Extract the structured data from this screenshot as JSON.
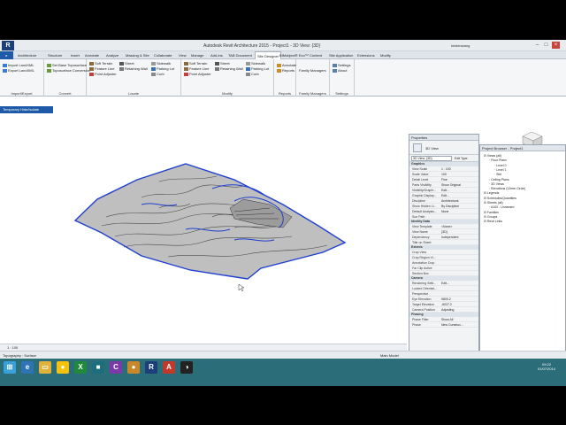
{
  "window": {
    "title": "Autodesk Revit Architecture 2015 -    Project1 - 3D View: {3D}",
    "search_hint": "Type a keyword or phrase",
    "user": "kristenwang",
    "logo": "R"
  },
  "tabs": [
    "Architecture",
    "Structure",
    "Insert",
    "Annotate",
    "Analyze",
    "Massing & Site",
    "Collaborate",
    "View",
    "Manage",
    "Add-Ins",
    "TAB Document",
    "Site Designer",
    "BIMobject® Eco™",
    "Content",
    "Site Application",
    "Extensions",
    "Modify"
  ],
  "active_tab_index": 11,
  "ribbon": {
    "panels": [
      {
        "title": "Import/Export",
        "items": [
          "Import LandXML",
          "Export LandXML"
        ]
      },
      {
        "title": "Convert",
        "items": [
          "Set Base Toposurface",
          "Toposurface Conversion"
        ]
      },
      {
        "title": "Locate",
        "items": [
          "Soft Terrain",
          "Feature Line",
          "Point Adjuster",
          "Street",
          "Retaining Wall",
          "Sidewalk",
          "Parking Lot",
          "Curb"
        ]
      },
      {
        "title": "Modify",
        "items": [
          "Soft Terrain",
          "Feature Line",
          "Point Adjuster",
          "Street",
          "Retaining Wall",
          "Sidewalk",
          "Parking Lot",
          "Curb"
        ]
      },
      {
        "title": "Reports",
        "items": [
          "Annotate",
          "Reports"
        ]
      },
      {
        "title": "Family Managers",
        "items": [
          "Family Managers"
        ]
      },
      {
        "title": "Settings",
        "items": [
          "Settings",
          "About"
        ]
      }
    ]
  },
  "view_tab": "Temporary Hide/Isolate",
  "properties": {
    "title": "Properties",
    "type": "3D View",
    "selector": "3D View: {3D}",
    "edit_type": "Edit Type",
    "sections": [
      {
        "name": "Graphics",
        "rows": [
          [
            "View Scale",
            "1 : 100"
          ],
          [
            "Scale Value",
            "100"
          ],
          [
            "Detail Level",
            "Fine"
          ],
          [
            "Parts Visibility",
            "Show Original"
          ],
          [
            "Visibility/Graphi...",
            "Edit..."
          ],
          [
            "Graphic Display...",
            "Edit..."
          ],
          [
            "Discipline",
            "Architectural"
          ],
          [
            "Show Hidden Li...",
            "By Discipline"
          ],
          [
            "Default Analysis...",
            "None"
          ],
          [
            "Sun Path",
            ""
          ]
        ]
      },
      {
        "name": "Identity Data",
        "rows": [
          [
            "View Template",
            "<None>"
          ],
          [
            "View Name",
            "{3D}"
          ],
          [
            "Dependency",
            "Independent"
          ],
          [
            "Title on Sheet",
            ""
          ]
        ]
      },
      {
        "name": "Extents",
        "rows": [
          [
            "Crop View",
            ""
          ],
          [
            "Crop Region Vi...",
            ""
          ],
          [
            "Annotation Crop",
            ""
          ],
          [
            "Far Clip Active",
            ""
          ],
          [
            "Section Box",
            ""
          ]
        ]
      },
      {
        "name": "Camera",
        "rows": [
          [
            "Rendering Setti...",
            "Edit..."
          ],
          [
            "Locked Orientat...",
            ""
          ],
          [
            "Perspective",
            ""
          ],
          [
            "Eye Elevation",
            "9800.2"
          ],
          [
            "Target Elevation",
            "-6037.2"
          ],
          [
            "Camera Position",
            "Adjusting"
          ]
        ]
      },
      {
        "name": "Phasing",
        "rows": [
          [
            "Phase Filter",
            "Show All"
          ],
          [
            "Phase",
            "New Construc..."
          ]
        ]
      }
    ],
    "help_link": "Properties help",
    "apply": "Apply"
  },
  "browser": {
    "title": "Project Browser - Project1",
    "items": [
      {
        "label": "Views (all)",
        "depth": 0
      },
      {
        "label": "Floor Plans",
        "depth": 1
      },
      {
        "label": "Level 0",
        "depth": 2
      },
      {
        "label": "Level 1",
        "depth": 2
      },
      {
        "label": "Site",
        "depth": 2
      },
      {
        "label": "Ceiling Plans",
        "depth": 1
      },
      {
        "label": "3D Views",
        "depth": 1
      },
      {
        "label": "Elevations (12mm Circle)",
        "depth": 1
      },
      {
        "label": "Legends",
        "depth": 0
      },
      {
        "label": "Schedules/Quantities",
        "depth": 0
      },
      {
        "label": "Sheets (all)",
        "depth": 0
      },
      {
        "label": "A100 - Unnamed",
        "depth": 1
      },
      {
        "label": "Families",
        "depth": 0
      },
      {
        "label": "Groups",
        "depth": 0
      },
      {
        "label": "Revit Links",
        "depth": 0
      }
    ]
  },
  "view_control": {
    "scale": "1 : 100"
  },
  "status": {
    "text": "Topography : Surface",
    "model": "Main Model"
  },
  "taskbar": {
    "time": "09:22",
    "date": "01/07/2014"
  },
  "colors": {
    "accent": "#1e5aa8",
    "terrain_edge": "#1f3fd0",
    "taskbar": "#2b6e7a"
  }
}
